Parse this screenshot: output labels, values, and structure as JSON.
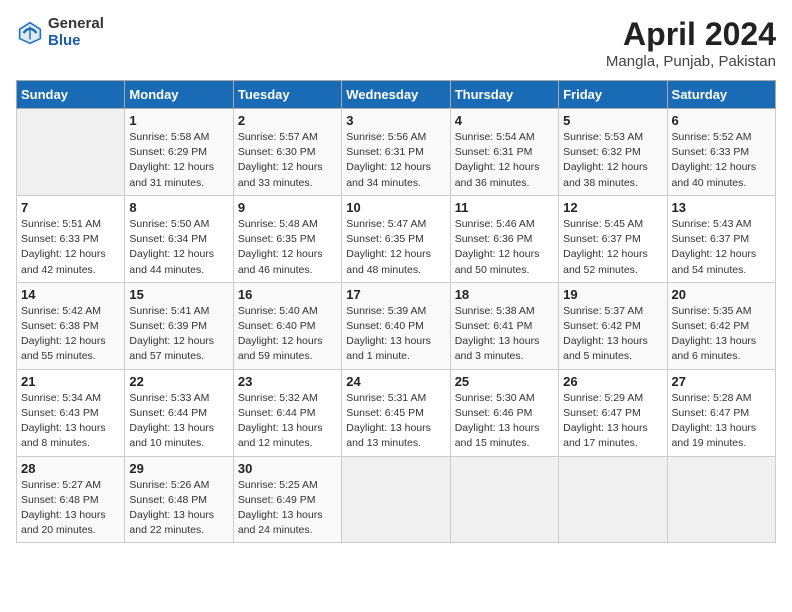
{
  "header": {
    "logo_general": "General",
    "logo_blue": "Blue",
    "title": "April 2024",
    "subtitle": "Mangla, Punjab, Pakistan"
  },
  "days_of_week": [
    "Sunday",
    "Monday",
    "Tuesday",
    "Wednesday",
    "Thursday",
    "Friday",
    "Saturday"
  ],
  "weeks": [
    [
      {
        "day": "",
        "sunrise": "",
        "sunset": "",
        "daylight": ""
      },
      {
        "day": "1",
        "sunrise": "Sunrise: 5:58 AM",
        "sunset": "Sunset: 6:29 PM",
        "daylight": "Daylight: 12 hours and 31 minutes."
      },
      {
        "day": "2",
        "sunrise": "Sunrise: 5:57 AM",
        "sunset": "Sunset: 6:30 PM",
        "daylight": "Daylight: 12 hours and 33 minutes."
      },
      {
        "day": "3",
        "sunrise": "Sunrise: 5:56 AM",
        "sunset": "Sunset: 6:31 PM",
        "daylight": "Daylight: 12 hours and 34 minutes."
      },
      {
        "day": "4",
        "sunrise": "Sunrise: 5:54 AM",
        "sunset": "Sunset: 6:31 PM",
        "daylight": "Daylight: 12 hours and 36 minutes."
      },
      {
        "day": "5",
        "sunrise": "Sunrise: 5:53 AM",
        "sunset": "Sunset: 6:32 PM",
        "daylight": "Daylight: 12 hours and 38 minutes."
      },
      {
        "day": "6",
        "sunrise": "Sunrise: 5:52 AM",
        "sunset": "Sunset: 6:33 PM",
        "daylight": "Daylight: 12 hours and 40 minutes."
      }
    ],
    [
      {
        "day": "7",
        "sunrise": "Sunrise: 5:51 AM",
        "sunset": "Sunset: 6:33 PM",
        "daylight": "Daylight: 12 hours and 42 minutes."
      },
      {
        "day": "8",
        "sunrise": "Sunrise: 5:50 AM",
        "sunset": "Sunset: 6:34 PM",
        "daylight": "Daylight: 12 hours and 44 minutes."
      },
      {
        "day": "9",
        "sunrise": "Sunrise: 5:48 AM",
        "sunset": "Sunset: 6:35 PM",
        "daylight": "Daylight: 12 hours and 46 minutes."
      },
      {
        "day": "10",
        "sunrise": "Sunrise: 5:47 AM",
        "sunset": "Sunset: 6:35 PM",
        "daylight": "Daylight: 12 hours and 48 minutes."
      },
      {
        "day": "11",
        "sunrise": "Sunrise: 5:46 AM",
        "sunset": "Sunset: 6:36 PM",
        "daylight": "Daylight: 12 hours and 50 minutes."
      },
      {
        "day": "12",
        "sunrise": "Sunrise: 5:45 AM",
        "sunset": "Sunset: 6:37 PM",
        "daylight": "Daylight: 12 hours and 52 minutes."
      },
      {
        "day": "13",
        "sunrise": "Sunrise: 5:43 AM",
        "sunset": "Sunset: 6:37 PM",
        "daylight": "Daylight: 12 hours and 54 minutes."
      }
    ],
    [
      {
        "day": "14",
        "sunrise": "Sunrise: 5:42 AM",
        "sunset": "Sunset: 6:38 PM",
        "daylight": "Daylight: 12 hours and 55 minutes."
      },
      {
        "day": "15",
        "sunrise": "Sunrise: 5:41 AM",
        "sunset": "Sunset: 6:39 PM",
        "daylight": "Daylight: 12 hours and 57 minutes."
      },
      {
        "day": "16",
        "sunrise": "Sunrise: 5:40 AM",
        "sunset": "Sunset: 6:40 PM",
        "daylight": "Daylight: 12 hours and 59 minutes."
      },
      {
        "day": "17",
        "sunrise": "Sunrise: 5:39 AM",
        "sunset": "Sunset: 6:40 PM",
        "daylight": "Daylight: 13 hours and 1 minute."
      },
      {
        "day": "18",
        "sunrise": "Sunrise: 5:38 AM",
        "sunset": "Sunset: 6:41 PM",
        "daylight": "Daylight: 13 hours and 3 minutes."
      },
      {
        "day": "19",
        "sunrise": "Sunrise: 5:37 AM",
        "sunset": "Sunset: 6:42 PM",
        "daylight": "Daylight: 13 hours and 5 minutes."
      },
      {
        "day": "20",
        "sunrise": "Sunrise: 5:35 AM",
        "sunset": "Sunset: 6:42 PM",
        "daylight": "Daylight: 13 hours and 6 minutes."
      }
    ],
    [
      {
        "day": "21",
        "sunrise": "Sunrise: 5:34 AM",
        "sunset": "Sunset: 6:43 PM",
        "daylight": "Daylight: 13 hours and 8 minutes."
      },
      {
        "day": "22",
        "sunrise": "Sunrise: 5:33 AM",
        "sunset": "Sunset: 6:44 PM",
        "daylight": "Daylight: 13 hours and 10 minutes."
      },
      {
        "day": "23",
        "sunrise": "Sunrise: 5:32 AM",
        "sunset": "Sunset: 6:44 PM",
        "daylight": "Daylight: 13 hours and 12 minutes."
      },
      {
        "day": "24",
        "sunrise": "Sunrise: 5:31 AM",
        "sunset": "Sunset: 6:45 PM",
        "daylight": "Daylight: 13 hours and 13 minutes."
      },
      {
        "day": "25",
        "sunrise": "Sunrise: 5:30 AM",
        "sunset": "Sunset: 6:46 PM",
        "daylight": "Daylight: 13 hours and 15 minutes."
      },
      {
        "day": "26",
        "sunrise": "Sunrise: 5:29 AM",
        "sunset": "Sunset: 6:47 PM",
        "daylight": "Daylight: 13 hours and 17 minutes."
      },
      {
        "day": "27",
        "sunrise": "Sunrise: 5:28 AM",
        "sunset": "Sunset: 6:47 PM",
        "daylight": "Daylight: 13 hours and 19 minutes."
      }
    ],
    [
      {
        "day": "28",
        "sunrise": "Sunrise: 5:27 AM",
        "sunset": "Sunset: 6:48 PM",
        "daylight": "Daylight: 13 hours and 20 minutes."
      },
      {
        "day": "29",
        "sunrise": "Sunrise: 5:26 AM",
        "sunset": "Sunset: 6:48 PM",
        "daylight": "Daylight: 13 hours and 22 minutes."
      },
      {
        "day": "30",
        "sunrise": "Sunrise: 5:25 AM",
        "sunset": "Sunset: 6:49 PM",
        "daylight": "Daylight: 13 hours and 24 minutes."
      },
      {
        "day": "",
        "sunrise": "",
        "sunset": "",
        "daylight": ""
      },
      {
        "day": "",
        "sunrise": "",
        "sunset": "",
        "daylight": ""
      },
      {
        "day": "",
        "sunrise": "",
        "sunset": "",
        "daylight": ""
      },
      {
        "day": "",
        "sunrise": "",
        "sunset": "",
        "daylight": ""
      }
    ]
  ]
}
